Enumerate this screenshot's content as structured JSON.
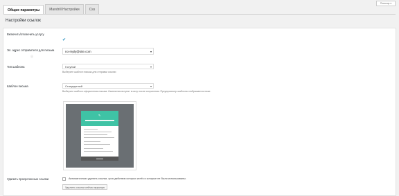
{
  "tabs": [
    {
      "label": "Общие параметры"
    },
    {
      "label": "Mandrill Настройки"
    },
    {
      "label": "Css"
    }
  ],
  "help_label": "Помощь ▾",
  "section_title": "Настройки ссылок",
  "rows": {
    "enable_label": "Включить/отключить услугу",
    "sender_label": "Эл. адрес отправителя для письма",
    "sender_value": "no-reply@site.com",
    "template_label": "Тип шаблона",
    "template_value": "Голубой",
    "template_desc": "Выберите шаблон письма для отправки ссылки",
    "layout_label": "Шаблон письма",
    "layout_value": "Стандартный",
    "layout_desc": "Выберите шаблон оформления письма. Изменения вступят в силу после сохранения. Предпросмотр шаблона отображается ниже.",
    "cleanup_label": "Удалить просроченные ссылки",
    "cleanup_checkbox_text": "Автоматически удалять ссылки, срок действия которых истёк и которые не были использованы.",
    "cleanup_button": "Удалить ссылки сейчас вручную"
  },
  "colors": {
    "accent": "#3fc3a5",
    "check": "#1e8cbe"
  }
}
